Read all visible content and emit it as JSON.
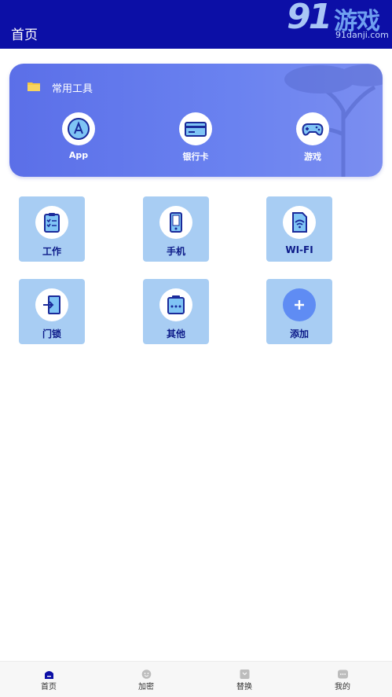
{
  "appbar": {
    "title": "首页"
  },
  "watermark": {
    "number": "91",
    "text": "游戏",
    "domain": "91danji.com"
  },
  "tools": {
    "title": "常用工具",
    "items": [
      {
        "label": "App",
        "icon": "app-store-icon"
      },
      {
        "label": "银行卡",
        "icon": "bank-card-icon"
      },
      {
        "label": "游戏",
        "icon": "gamepad-icon"
      }
    ]
  },
  "grid": {
    "items": [
      {
        "label": "工作",
        "icon": "clipboard-icon"
      },
      {
        "label": "手机",
        "icon": "phone-icon"
      },
      {
        "label": "WI-FI",
        "icon": "wifi-icon"
      },
      {
        "label": "门锁",
        "icon": "door-lock-icon"
      },
      {
        "label": "其他",
        "icon": "other-icon"
      },
      {
        "label": "添加",
        "icon": "plus-icon"
      }
    ]
  },
  "nav": {
    "items": [
      {
        "label": "首页",
        "icon": "home-icon",
        "active": true
      },
      {
        "label": "加密",
        "icon": "encrypt-icon",
        "active": false
      },
      {
        "label": "替换",
        "icon": "replace-icon",
        "active": false
      },
      {
        "label": "我的",
        "icon": "profile-icon",
        "active": false
      }
    ]
  },
  "colors": {
    "appbar": "#0c0fa6",
    "card": "#6a82f0",
    "tile": "#a8cdf3",
    "label": "#0c1a88",
    "icon": "#1a2a9a"
  }
}
